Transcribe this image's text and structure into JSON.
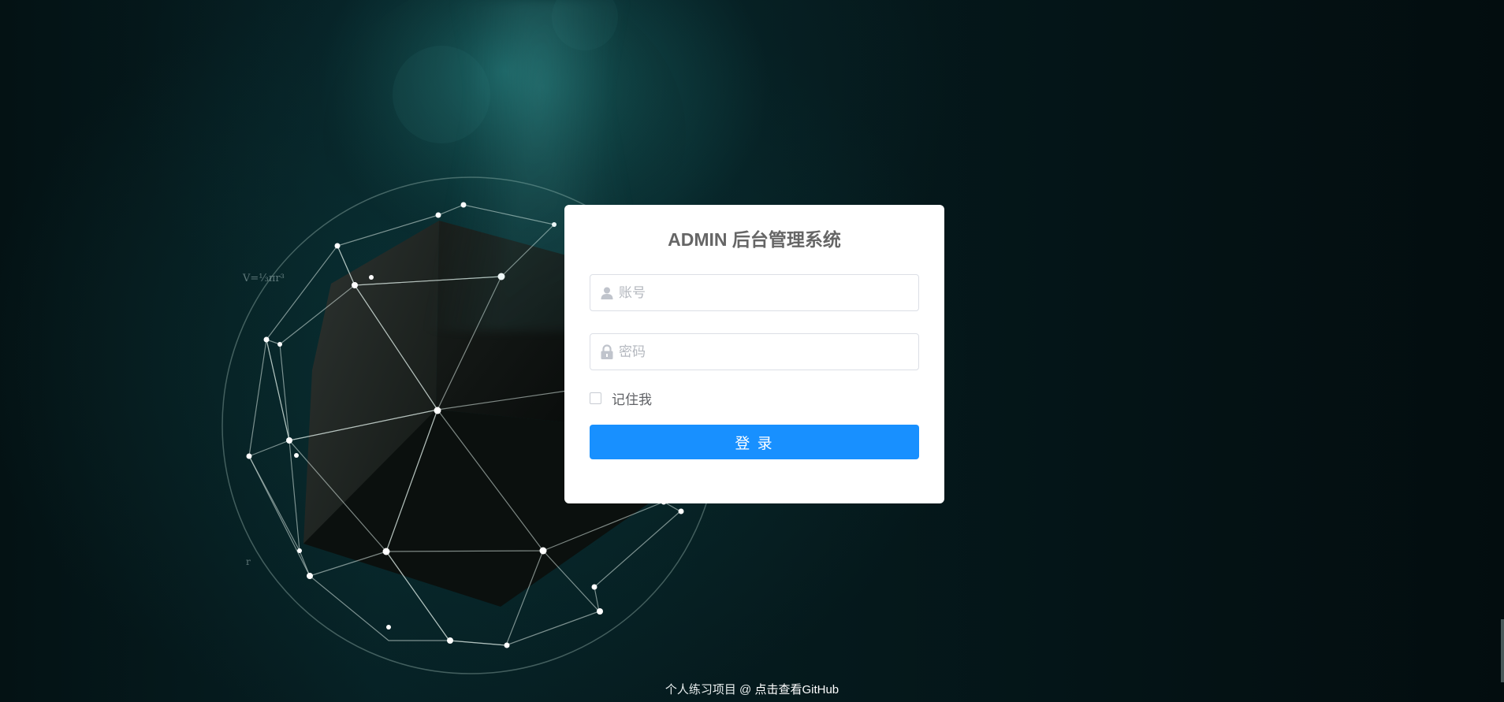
{
  "app": {
    "title": "ADMIN 后台管理系统"
  },
  "form": {
    "username_placeholder": "账号",
    "password_placeholder": "密码",
    "remember_label": "记住我",
    "login_button_label": "登 录",
    "remember_checked": false
  },
  "footer": {
    "text": "个人练习项目 @ ",
    "link_text": "点击查看GitHub"
  },
  "background": {
    "formula_text": "V=⅓πr³",
    "formula_small": "r"
  },
  "colors": {
    "primary": "#1890ff",
    "title": "#666666",
    "card": "#ffffff"
  },
  "icons": {
    "username": "user-icon",
    "password": "lock-icon"
  }
}
